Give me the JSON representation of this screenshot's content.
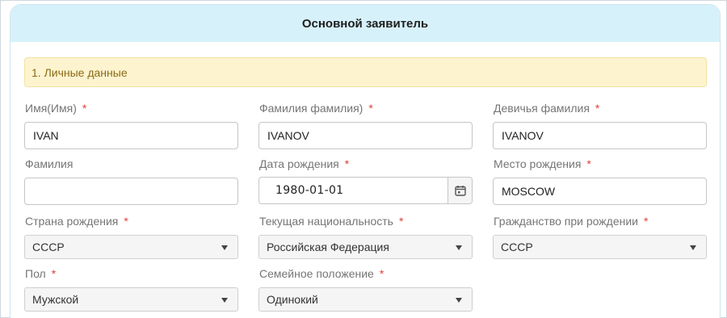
{
  "header": {
    "title": "Основной заявитель"
  },
  "section": {
    "title": "1. Личные данные"
  },
  "required_mark": "*",
  "fields": {
    "first_name": {
      "label": "Имя(Имя)",
      "value": "IVAN"
    },
    "last_name": {
      "label": "Фамилия фамилия)",
      "value": "IVANOV"
    },
    "maiden_name": {
      "label": "Девичья фамилия",
      "value": "IVANOV"
    },
    "patronymic": {
      "label": "Фамилия",
      "value": ""
    },
    "birth_date": {
      "label": "Дата рождения",
      "value": "1980-01-01"
    },
    "birth_place": {
      "label": "Место рождения",
      "value": "MOSCOW"
    },
    "birth_country": {
      "label": "Страна рождения",
      "value": "СССР"
    },
    "current_nationality": {
      "label": "Текущая национальность",
      "value": "Российская Федерация"
    },
    "citizenship_at_birth": {
      "label": "Гражданство при рождении",
      "value": "СССР"
    },
    "sex": {
      "label": "Пол",
      "value": "Мужской"
    },
    "marital_status": {
      "label": "Семейное положение",
      "value": "Одинокий"
    }
  },
  "icons": {
    "calendar": "calendar-icon",
    "dropdown": "caret-down-icon"
  }
}
